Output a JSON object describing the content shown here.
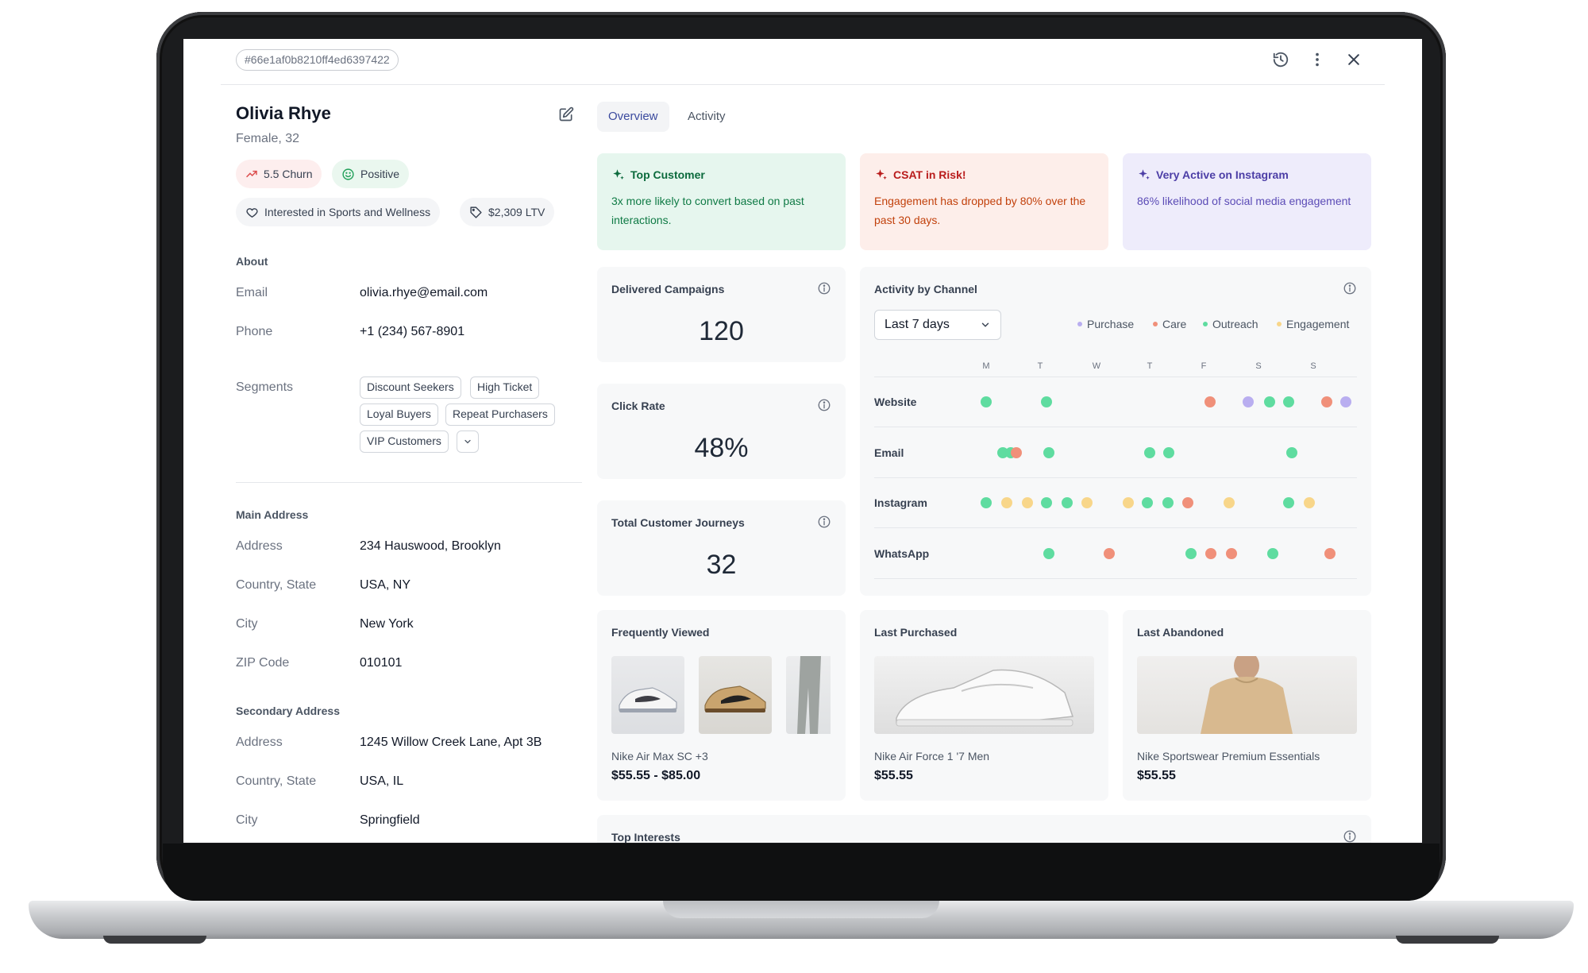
{
  "record_id": "#66e1af0b8210ff4ed6397422",
  "profile": {
    "name": "Olivia Rhye",
    "subtitle": "Female, 32",
    "churn": "5.5 Churn",
    "sentiment": "Positive",
    "interest": "Interested in Sports and Wellness",
    "ltv": "$2,309 LTV"
  },
  "about": {
    "heading": "About",
    "email_label": "Email",
    "email": "olivia.rhye@email.com",
    "phone_label": "Phone",
    "phone": "+1 (234) 567-8901",
    "segments_label": "Segments",
    "segments": [
      "Discount Seekers",
      "High Ticket",
      "Loyal Buyers",
      "Repeat Purchasers",
      "VIP Customers"
    ]
  },
  "main_address": {
    "heading": "Main Address",
    "address_label": "Address",
    "address": "234 Hauswood, Brooklyn",
    "country_label": "Country, State",
    "country": "USA, NY",
    "city_label": "City",
    "city": "New York",
    "zip_label": "ZIP Code",
    "zip": "010101"
  },
  "secondary_address": {
    "heading": "Secondary Address",
    "address_label": "Address",
    "address": "1245 Willow Creek Lane, Apt 3B",
    "country_label": "Country, State",
    "country": "USA, IL",
    "city_label": "City",
    "city": "Springfield"
  },
  "tabs": [
    {
      "label": "Overview",
      "active": true
    },
    {
      "label": "Activity",
      "active": false
    }
  ],
  "insights": [
    {
      "title": "Top Customer",
      "text": "3x more likely to convert based on past interactions."
    },
    {
      "title": "CSAT in Risk!",
      "text": "Engagement has dropped by 80% over the past 30 days."
    },
    {
      "title": "Very Active on Instagram",
      "text": "86% likelihood of social media engagement"
    }
  ],
  "metrics": [
    {
      "title": "Delivered Campaigns",
      "value": "120"
    },
    {
      "title": "Click Rate",
      "value": "48%"
    },
    {
      "title": "Total Customer Journeys",
      "value": "32"
    }
  ],
  "activity": {
    "title": "Activity by Channel",
    "range": "Last 7 days",
    "days": [
      "M",
      "T",
      "W",
      "T",
      "F",
      "S",
      "S"
    ],
    "legend": [
      {
        "name": "Purchase",
        "color": "#b9aef0"
      },
      {
        "name": "Care",
        "color": "#f0907a"
      },
      {
        "name": "Outreach",
        "color": "#5fdca0"
      },
      {
        "name": "Engagement",
        "color": "#f8d68a"
      }
    ],
    "channels": [
      {
        "name": "Website",
        "events": [
          {
            "day": 0.0,
            "type": "Outreach"
          },
          {
            "day": 1.1,
            "type": "Outreach"
          },
          {
            "day": 4.1,
            "type": "Care"
          },
          {
            "day": 4.8,
            "type": "Purchase"
          },
          {
            "day": 5.2,
            "type": "Outreach"
          },
          {
            "day": 5.55,
            "type": "Outreach"
          },
          {
            "day": 6.25,
            "type": "Care"
          },
          {
            "day": 6.6,
            "type": "Purchase"
          }
        ]
      },
      {
        "name": "Email",
        "events": [
          {
            "day": 0.3,
            "type": "Outreach"
          },
          {
            "day": 0.45,
            "type": "Outreach"
          },
          {
            "day": 0.55,
            "type": "Care"
          },
          {
            "day": 1.15,
            "type": "Outreach"
          },
          {
            "day": 3.0,
            "type": "Outreach"
          },
          {
            "day": 3.35,
            "type": "Outreach"
          },
          {
            "day": 5.6,
            "type": "Outreach"
          }
        ]
      },
      {
        "name": "Instagram",
        "events": [
          {
            "day": 0.0,
            "type": "Outreach"
          },
          {
            "day": 0.38,
            "type": "Engagement"
          },
          {
            "day": 0.75,
            "type": "Engagement"
          },
          {
            "day": 1.1,
            "type": "Outreach"
          },
          {
            "day": 1.48,
            "type": "Outreach"
          },
          {
            "day": 1.85,
            "type": "Engagement"
          },
          {
            "day": 2.6,
            "type": "Engagement"
          },
          {
            "day": 2.95,
            "type": "Outreach"
          },
          {
            "day": 3.33,
            "type": "Outreach"
          },
          {
            "day": 3.7,
            "type": "Care"
          },
          {
            "day": 4.45,
            "type": "Engagement"
          },
          {
            "day": 5.55,
            "type": "Outreach"
          },
          {
            "day": 5.92,
            "type": "Engagement"
          }
        ]
      },
      {
        "name": "WhatsApp",
        "events": [
          {
            "day": 1.15,
            "type": "Outreach"
          },
          {
            "day": 2.25,
            "type": "Care"
          },
          {
            "day": 3.75,
            "type": "Outreach"
          },
          {
            "day": 4.12,
            "type": "Care"
          },
          {
            "day": 4.5,
            "type": "Care"
          },
          {
            "day": 5.25,
            "type": "Outreach"
          },
          {
            "day": 6.3,
            "type": "Care"
          }
        ]
      }
    ]
  },
  "products": [
    {
      "title": "Frequently Viewed",
      "name": "Nike Air Max SC +3",
      "price": "$55.55 - $85.00"
    },
    {
      "title": "Last Purchased",
      "name": "Nike Air Force 1 '7 Men",
      "price": "$55.55"
    },
    {
      "title": "Last Abandoned",
      "name": "Nike Sportswear Premium Essentials",
      "price": "$55.55"
    }
  ],
  "bottom_card_title": "Top Interests",
  "icons": [
    "history-icon",
    "more-vertical-icon",
    "close-icon",
    "edit-icon",
    "trend-up-icon",
    "smile-icon",
    "heart-icon",
    "tag-icon",
    "sparkle-icon",
    "info-icon",
    "chevron-down-icon"
  ]
}
